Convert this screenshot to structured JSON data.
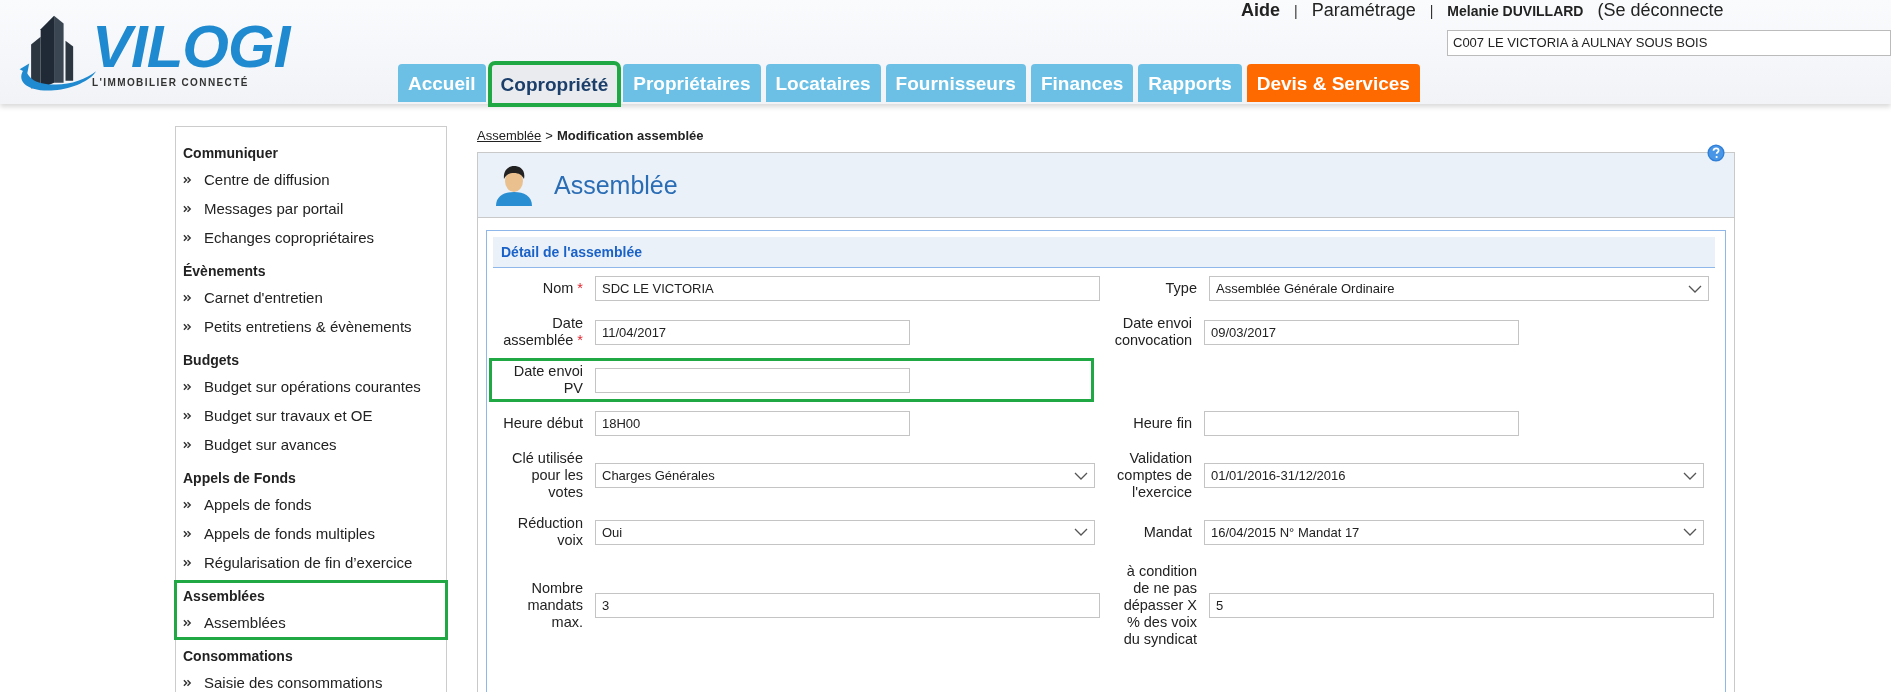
{
  "logo": {
    "name": "VILOGI",
    "tagline": "L'IMMOBILIER CONNECTÉ"
  },
  "top_links": [
    {
      "label": "Aide",
      "kind": "link"
    },
    {
      "label": "|",
      "kind": "separator"
    },
    {
      "label": "Paramétrage",
      "kind": "link"
    },
    {
      "label": "|",
      "kind": "separator"
    },
    {
      "label": "Melanie DUVILLARD",
      "kind": "user"
    },
    {
      "label": "(Se déconnecte",
      "kind": "link"
    }
  ],
  "site_selector": {
    "value": "C007 LE VICTORIA à AULNAY SOUS BOIS"
  },
  "tabs": [
    {
      "label": "Accueil",
      "selected": false,
      "highlighted": false,
      "color": "#6cc0e5"
    },
    {
      "label": "Copropriété",
      "selected": true,
      "highlighted": true
    },
    {
      "label": "Propriétaires",
      "selected": false,
      "highlighted": false,
      "color": "#6cc0e5"
    },
    {
      "label": "Locataires",
      "selected": false,
      "highlighted": false,
      "color": "#6cc0e5"
    },
    {
      "label": "Fournisseurs",
      "selected": false,
      "highlighted": false,
      "color": "#6cc0e5"
    },
    {
      "label": "Finances",
      "selected": false,
      "highlighted": false,
      "color": "#6cc0e5"
    },
    {
      "label": "Rapports",
      "selected": false,
      "highlighted": false,
      "color": "#6cc0e5"
    },
    {
      "label": "Devis & Services",
      "selected": false,
      "highlighted": false,
      "color": "#ff6a00"
    }
  ],
  "sidebar": {
    "groups": [
      {
        "title": "Communiquer",
        "highlighted": false,
        "items": [
          {
            "label": "Centre de diffusion"
          },
          {
            "label": "Messages par portail"
          },
          {
            "label": "Echanges copropriétaires"
          }
        ]
      },
      {
        "title": "Évènements",
        "highlighted": false,
        "items": [
          {
            "label": "Carnet d'entretien"
          },
          {
            "label": "Petits entretiens & évènements"
          }
        ]
      },
      {
        "title": "Budgets",
        "highlighted": false,
        "items": [
          {
            "label": "Budget sur opérations courantes"
          },
          {
            "label": "Budget sur travaux et OE"
          },
          {
            "label": "Budget sur avances"
          }
        ]
      },
      {
        "title": "Appels de Fonds",
        "highlighted": false,
        "items": [
          {
            "label": "Appels de fonds"
          },
          {
            "label": "Appels de fonds multiples"
          },
          {
            "label": "Régularisation de fin d’exercice"
          }
        ]
      },
      {
        "title": "Assemblées",
        "highlighted": true,
        "items": [
          {
            "label": "Assemblées"
          }
        ]
      },
      {
        "title": "Consommations",
        "highlighted": false,
        "items": [
          {
            "label": "Saisie des consommations"
          }
        ]
      }
    ]
  },
  "breadcrumb": {
    "link": "Assemblée",
    "separator": ">",
    "current": "Modification assemblée"
  },
  "panel": {
    "title": "Assemblée",
    "section_title": "Détail de l'assemblée",
    "rows": [
      {
        "highlighted": false,
        "left": {
          "label": "Nom",
          "required_mark": "*",
          "kind": "text",
          "value": "SDC LE VICTORIA"
        },
        "right": {
          "label": "Type",
          "kind": "select",
          "value": "Assemblée Générale Ordinaire"
        }
      },
      {
        "highlighted": false,
        "left": {
          "label": "Date assemblée",
          "required_mark": "*",
          "kind": "date",
          "value": "11/04/2017"
        },
        "right": {
          "label": "Date envoi convocation",
          "kind": "date",
          "value": "09/03/2017"
        }
      },
      {
        "highlighted": true,
        "left": {
          "label": "Date envoi PV",
          "kind": "date"
        }
      },
      {
        "highlighted": false,
        "left": {
          "label": "Heure début",
          "kind": "time",
          "value": "18H00"
        },
        "right": {
          "label": "Heure fin",
          "kind": "time"
        }
      },
      {
        "highlighted": false,
        "left": {
          "label": "Clé utilisée pour les votes",
          "kind": "select",
          "value": "Charges Générales"
        },
        "right": {
          "label": "Validation comptes de l'exercice",
          "kind": "select",
          "value": "01/01/2016-31/12/2016"
        }
      },
      {
        "highlighted": false,
        "left": {
          "label": "Réduction voix",
          "kind": "select",
          "value": "Oui"
        },
        "right": {
          "label": "Mandat",
          "kind": "select",
          "value": "16/04/2015 N° Mandat 17"
        }
      },
      {
        "highlighted": false,
        "left": {
          "label": "Nombre mandats max.",
          "kind": "text",
          "value": "3"
        },
        "right": {
          "label": "à condition de ne pas dépasser X % des voix du syndicat",
          "kind": "text",
          "value": "5"
        }
      }
    ]
  }
}
